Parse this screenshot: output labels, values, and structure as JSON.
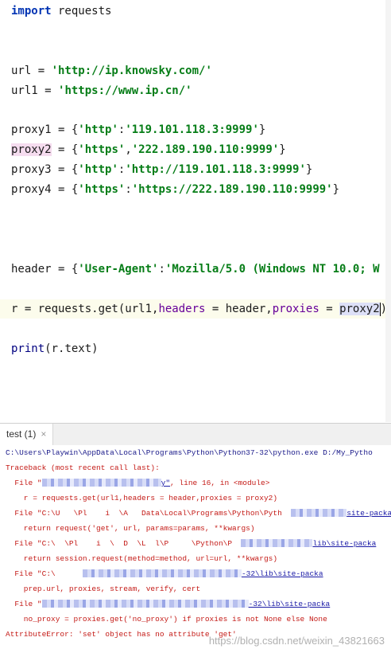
{
  "editor": {
    "import_kw": "import",
    "import_mod": " requests",
    "url_prefix": "url = ",
    "url_value": "'http://ip.knowsky.com/'",
    "url1_prefix": "url1 = ",
    "url1_value": "'https://www.ip.cn/'",
    "proxy1_var": "proxy1 = {",
    "proxy1_key": "'http'",
    "proxy1_sep": ":",
    "proxy1_val": "'119.101.118.3:9999'",
    "proxy1_end": "}",
    "proxy2_var": "proxy2",
    "proxy2_open": " = {",
    "proxy2_key": "'https'",
    "proxy2_sep": ",",
    "proxy2_val": "'222.189.190.110:9999'",
    "proxy2_end": "}",
    "proxy3_var": "proxy3 = {",
    "proxy3_key": "'http'",
    "proxy3_sep": ":",
    "proxy3_val": "'http://119.101.118.3:9999'",
    "proxy3_end": "}",
    "proxy4_var": "proxy4 = {",
    "proxy4_key": "'https'",
    "proxy4_sep": ":",
    "proxy4_val": "'https://222.189.190.110:9999'",
    "proxy4_end": "}",
    "header_var": "header = {",
    "header_key": "'User-Agent'",
    "header_sep": ":",
    "header_val": "'Mozilla/5.0 (Windows NT 10.0; W",
    "r_prefix": "r = requests.get(url1,",
    "r_kw1": "headers",
    "r_mid1": " = header,",
    "r_kw2": "proxies",
    "r_mid2": " = ",
    "r_arg": "proxy2",
    "r_end": ")",
    "print_fn": "print",
    "print_arg": "(r.text)"
  },
  "run_tab": {
    "label": "test (1)",
    "close": "×"
  },
  "console": {
    "cmd": "C:\\Users\\Playwin\\AppData\\Local\\Programs\\Python\\Python37-32\\python.exe D:/My_Pytho",
    "l1": "Traceback (most recent call last):",
    "l2_a": "  File ",
    "l2_b": "\"",
    "l2_link": "y\"",
    "l2_c": ", line 16, in <module>",
    "l3": "    r = requests.get(url1,headers = header,proxies = proxy2)",
    "l4_a": "  File ",
    "l4_b": "\"C:\\U   \\Pl    i  \\A   Data\\Local\\Programs\\Python\\Pyth  ",
    "l4_link": "site-packa",
    "l5": "    return request('get', url, params=params, **kwargs)",
    "l6_a": "  File ",
    "l6_b": "\"C:\\  \\Pl    i  \\  D  \\L  l\\P     \\Python\\P  ",
    "l6_link": "lib\\site-packa",
    "l7": "    return session.request(method=method, url=url, **kwargs)",
    "l8_a": "  File ",
    "l8_b": "\"C:\\      ",
    "l8_link": "-32\\lib\\site-packa",
    "l9": "    prep.url, proxies, stream, verify, cert",
    "l10_a": "  File ",
    "l10_b": "\"",
    "l10_link": "-32\\lib\\site-packa",
    "l11": "    no_proxy = proxies.get('no_proxy') if proxies is not None else None",
    "l12": "AttributeError: 'set' object has no attribute 'get'"
  },
  "watermark": "https://blog.csdn.net/weixin_43821663",
  "colors": {
    "keyword": "#0033b3",
    "string": "#067d17",
    "kwarg": "#660099",
    "error": "#c41a16",
    "current_line": "#fcfcec"
  }
}
